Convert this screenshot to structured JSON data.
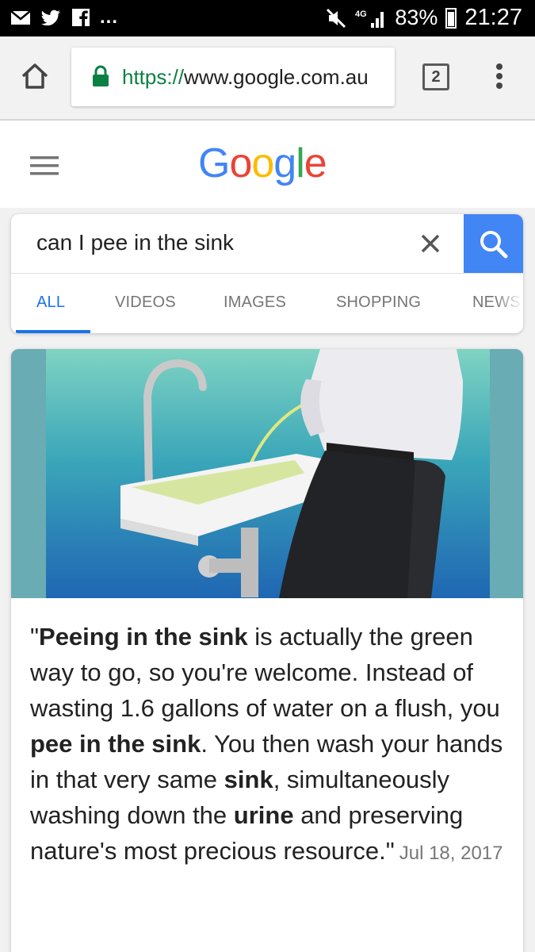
{
  "status_bar": {
    "notification_icons": [
      "mail-icon",
      "twitter-icon",
      "facebook-icon"
    ],
    "more_notifications": "...",
    "network": "4G",
    "battery": "83%",
    "time": "21:27"
  },
  "browser": {
    "url_scheme": "https://",
    "url_host": "www.google.com.au",
    "tab_count": "2"
  },
  "google": {
    "logo_letters": [
      {
        "ch": "G",
        "color": "#4285f4"
      },
      {
        "ch": "o",
        "color": "#ea4335"
      },
      {
        "ch": "o",
        "color": "#fbbc05"
      },
      {
        "ch": "g",
        "color": "#4285f4"
      },
      {
        "ch": "l",
        "color": "#34a853"
      },
      {
        "ch": "e",
        "color": "#ea4335"
      }
    ],
    "search_query": "can I pee in the sink",
    "tabs": [
      "ALL",
      "VIDEOS",
      "IMAGES",
      "SHOPPING",
      "NEWS"
    ],
    "active_tab": "ALL"
  },
  "result": {
    "snippet_parts": [
      {
        "text": "\"",
        "bold": false
      },
      {
        "text": "Peeing in the sink",
        "bold": true
      },
      {
        "text": " is actually the green way to go, so you're welcome. Instead of wasting 1.6 gallons of water on a flush, you ",
        "bold": false
      },
      {
        "text": "pee in the sink",
        "bold": true
      },
      {
        "text": ". You then wash your hands in that very same ",
        "bold": false
      },
      {
        "text": "sink",
        "bold": true
      },
      {
        "text": ", simultaneously washing down the ",
        "bold": false
      },
      {
        "text": "urine",
        "bold": true
      },
      {
        "text": " and preserving nature's most precious resource.\"",
        "bold": false
      }
    ],
    "date": "Jul 18, 2017"
  }
}
